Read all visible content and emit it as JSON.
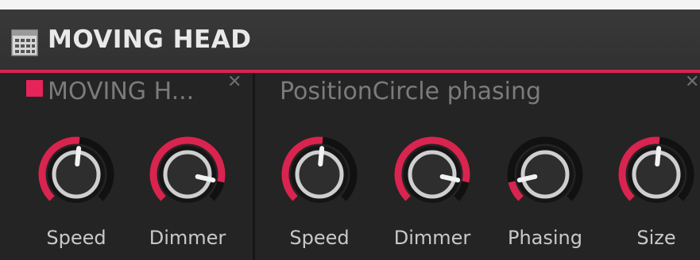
{
  "window": {
    "title": "MOVING HEAD",
    "icon": "window-grid-icon",
    "accent_color": "#d9244f"
  },
  "panels": [
    {
      "title": "MOVING H...",
      "indicator_color": "#e6245a",
      "close_glyph": "✕",
      "knobs": [
        {
          "label": "Speed",
          "value": 0.52
        },
        {
          "label": "Dimmer",
          "value": 0.88
        }
      ]
    },
    {
      "title": "PositionCircle phasing",
      "close_glyph": "✕",
      "knobs": [
        {
          "label": "Speed",
          "value": 0.52
        },
        {
          "label": "Dimmer",
          "value": 0.88
        },
        {
          "label": "Phasing",
          "value": 0.12
        },
        {
          "label": "Size",
          "value": 0.52
        }
      ]
    }
  ]
}
